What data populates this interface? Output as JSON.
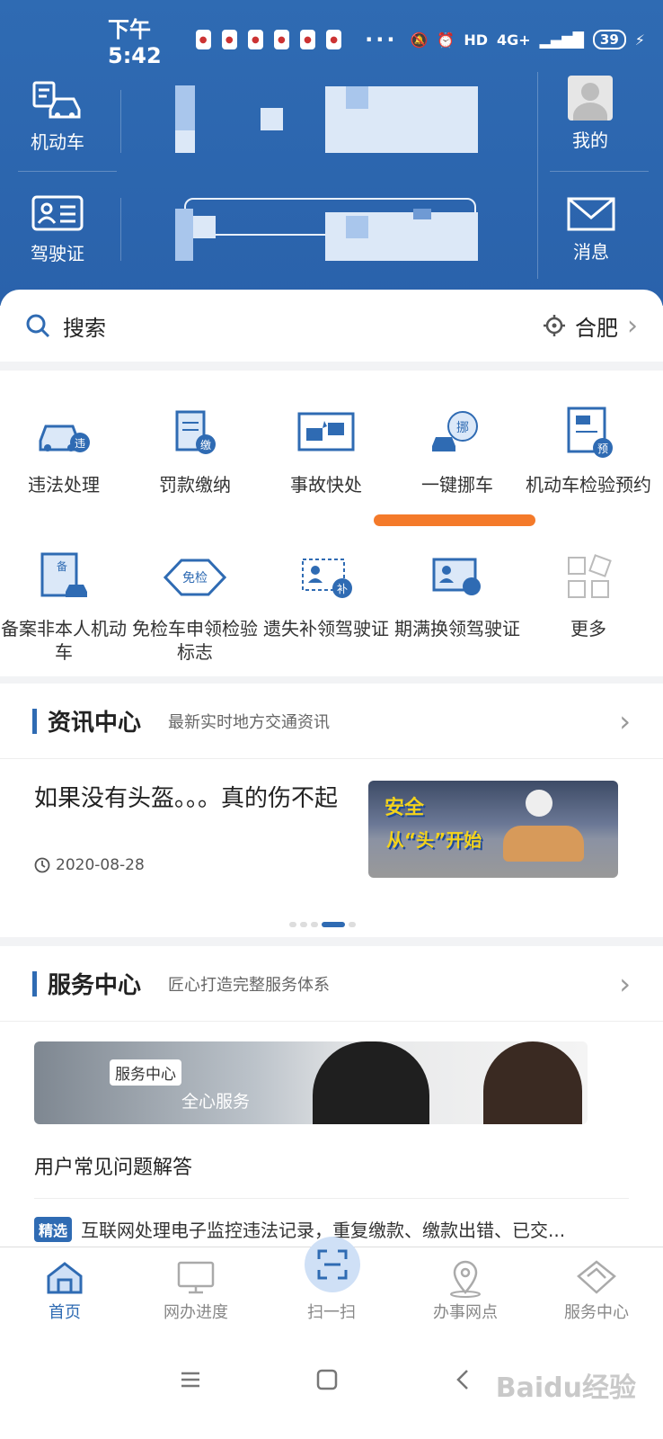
{
  "status": {
    "time": "下午5:42",
    "battery": "39",
    "network": "4G+",
    "hd": "HD"
  },
  "header": {
    "vehicle_label": "机动车",
    "license_label": "驾驶证",
    "mine_label": "我的",
    "message_label": "消息"
  },
  "search": {
    "label": "搜索",
    "city": "合肥"
  },
  "services": [
    {
      "label": "违法处理",
      "badge": "违"
    },
    {
      "label": "罚款缴纳",
      "badge": "缴"
    },
    {
      "label": "事故快处"
    },
    {
      "label": "一键挪车",
      "badge": "挪"
    },
    {
      "label": "机动车检验预约",
      "badge": "预"
    },
    {
      "label": "备案非本人机动车",
      "badge": "备"
    },
    {
      "label": "免检车申领检验标志",
      "badge": "免检"
    },
    {
      "label": "遗失补领驾驶证",
      "badge": "补"
    },
    {
      "label": "期满换领驾驶证"
    },
    {
      "label": "更多"
    }
  ],
  "news": {
    "title": "资讯中心",
    "subtitle": "最新实时地方交通资讯",
    "article_title": "如果没有头盔。。。真的伤不起",
    "article_date": "2020-08-28",
    "image_text_1": "安全",
    "image_text_2": "从“头”开始"
  },
  "service_center": {
    "title": "服务中心",
    "subtitle": "匠心打造完整服务体系",
    "banner_tag": "服务中心",
    "banner_text": "全心服务",
    "faq": "用户常见问题解答",
    "pick_badge": "精选",
    "pick_text": "互联网处理电子监控违法记录，重复缴款、缴款出错、已交..."
  },
  "tabs": [
    {
      "label": "首页"
    },
    {
      "label": "网办进度"
    },
    {
      "label": "扫一扫"
    },
    {
      "label": "办事网点"
    },
    {
      "label": "服务中心"
    }
  ],
  "colors": {
    "brand_blue": "#2f6bb3",
    "highlight_orange": "#f47a2a"
  },
  "watermark": "Baidu经验"
}
